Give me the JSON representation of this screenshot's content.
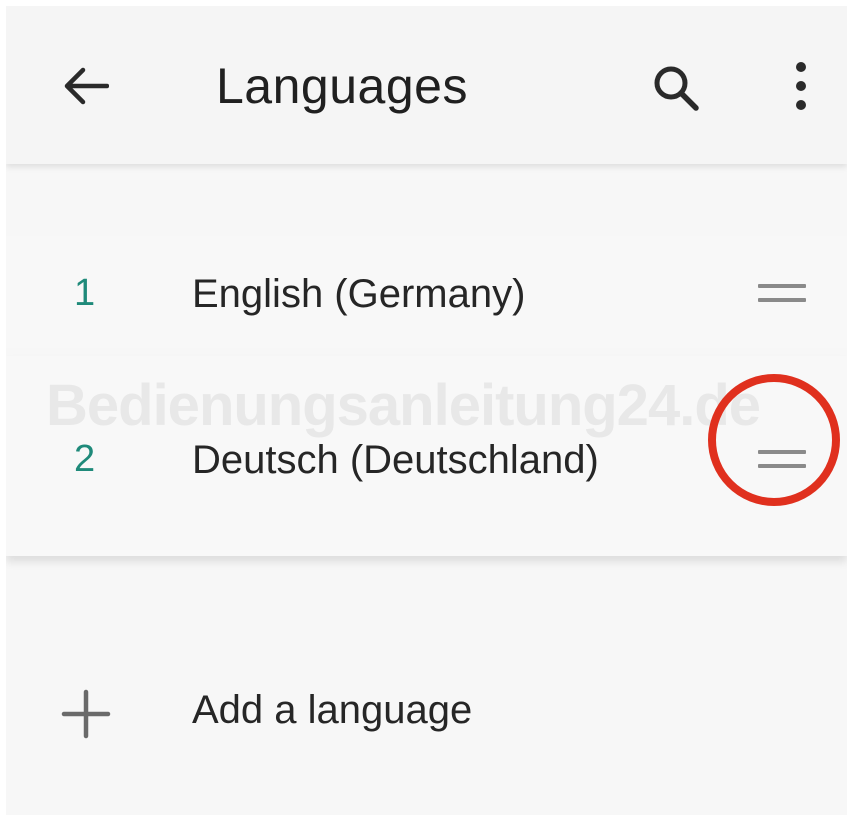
{
  "app_bar": {
    "title": "Languages",
    "back_icon": "arrow-left-icon",
    "search_icon": "search-icon",
    "more_icon": "more-vert-icon"
  },
  "languages": [
    {
      "number": "1",
      "name": "English (Germany)"
    },
    {
      "number": "2",
      "name": "Deutsch (Deutschland)"
    }
  ],
  "add_language": {
    "label": "Add a language",
    "icon": "plus-icon"
  },
  "watermark": "Bedienungsanleitung24.de",
  "colors": {
    "number_accent": "#1f8a7a",
    "highlight_circle": "#e0301e",
    "background": "#f7f7f7"
  }
}
